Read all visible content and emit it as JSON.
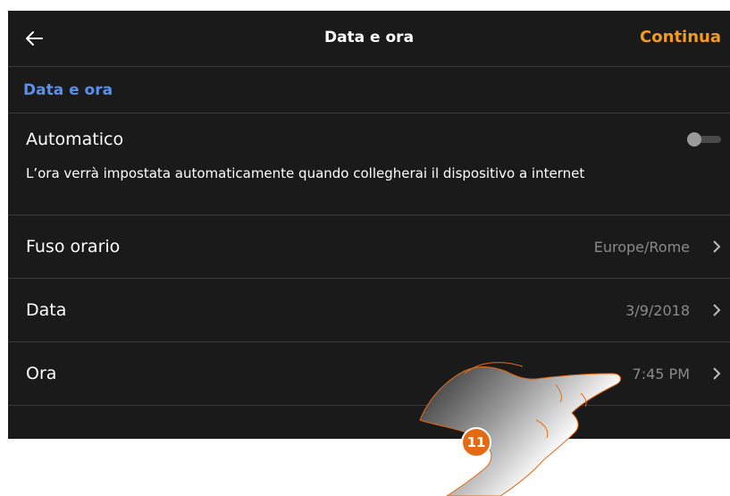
{
  "header": {
    "back_icon": "arrow-left-icon",
    "title": "Data e ora",
    "continue_label": "Continua"
  },
  "section": {
    "title": "Data e ora"
  },
  "automatic": {
    "label": "Automatico",
    "description": "L’ora verrà impostata automaticamente quando collegherai il dispositivo a internet",
    "enabled": false
  },
  "rows": [
    {
      "label": "Fuso orario",
      "value": "Europe/Rome",
      "icon": "chevron-right-icon"
    },
    {
      "label": "Data",
      "value": "3/9/2018",
      "icon": "chevron-right-icon"
    },
    {
      "label": "Ora",
      "value": "7:45 PM",
      "icon": "chevron-right-icon"
    }
  ],
  "callout": {
    "number": "11"
  },
  "colors": {
    "background": "#1a1a1a",
    "accent_orange": "#f39c1b",
    "section_blue": "#5c8fe8",
    "secondary_text": "#8a8a8a",
    "badge": "#e56a14"
  }
}
